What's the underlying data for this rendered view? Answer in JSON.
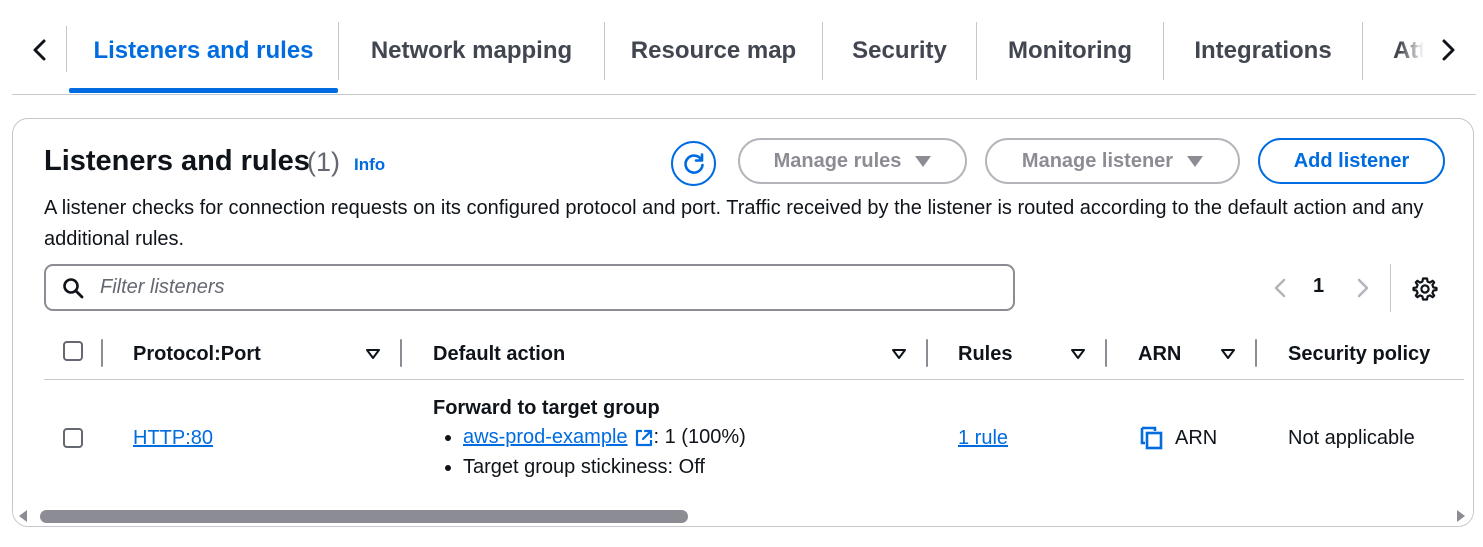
{
  "tabs": {
    "items": [
      {
        "label": "Listeners and rules",
        "active": true
      },
      {
        "label": "Network mapping",
        "active": false
      },
      {
        "label": "Resource map",
        "active": false
      },
      {
        "label": "Security",
        "active": false
      },
      {
        "label": "Monitoring",
        "active": false
      },
      {
        "label": "Integrations",
        "active": false
      },
      {
        "label": "Attributes",
        "active": false
      }
    ],
    "prev_icon": "chevron-left-icon",
    "next_icon": "chevron-right-icon"
  },
  "panel": {
    "title": "Listeners and rules",
    "count": "(1)",
    "info_link": "Info",
    "description": "A listener checks for connection requests on its configured protocol and port. Traffic received by the listener is routed according to the default action and any additional rules.",
    "buttons": {
      "manage_rules": "Manage rules",
      "manage_listener": "Manage listener",
      "add_listener": "Add listener"
    },
    "search": {
      "placeholder": "Filter listeners",
      "value": ""
    },
    "pagination": {
      "current_page": "1"
    }
  },
  "table": {
    "columns": [
      "Protocol:Port",
      "Default action",
      "Rules",
      "ARN",
      "Security policy"
    ],
    "rows": [
      {
        "protocol_port": "HTTP:80",
        "default_action_title": "Forward to target group",
        "target_group": "aws-prod-example",
        "target_weight": ": 1 (100%)",
        "stickiness": "Target group stickiness: Off",
        "rules": "1 rule",
        "arn": "ARN",
        "security_policy": "Not applicable"
      }
    ]
  },
  "colors": {
    "accent": "#006ce0",
    "text": "#0f141a",
    "muted": "#656871",
    "border": "#c6c6cd"
  }
}
